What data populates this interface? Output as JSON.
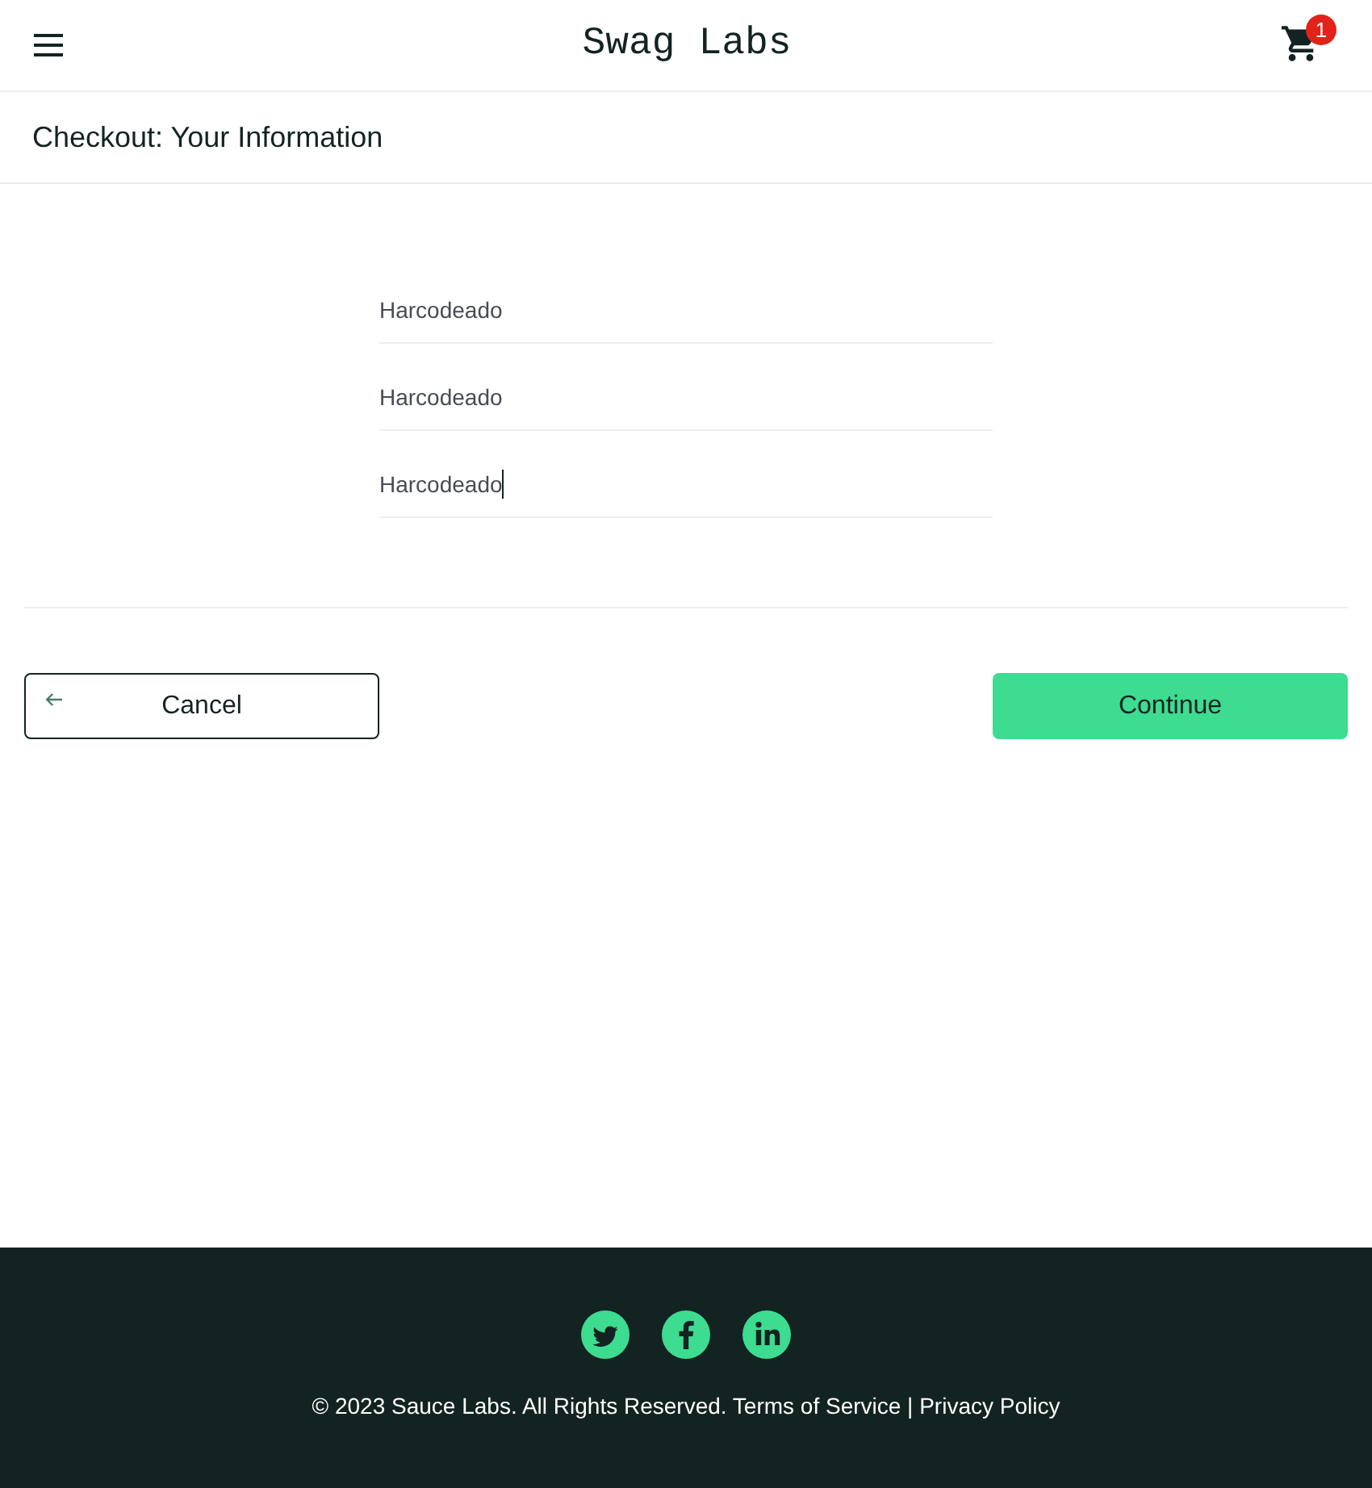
{
  "header": {
    "title": "Swag Labs",
    "cart_badge": "1"
  },
  "subheader": {
    "title": "Checkout: Your Information"
  },
  "form": {
    "fields": [
      {
        "value": "Harcodeado",
        "focused": false
      },
      {
        "value": "Harcodeado",
        "focused": false
      },
      {
        "value": "Harcodeado",
        "focused": true
      }
    ]
  },
  "buttons": [
    {
      "kind": "back",
      "label": "Cancel"
    },
    {
      "kind": "primary",
      "label": "Continue"
    }
  ],
  "footer": {
    "copyright": "© 2023 Sauce Labs. All Rights Reserved. Terms of Service | Privacy Policy"
  }
}
